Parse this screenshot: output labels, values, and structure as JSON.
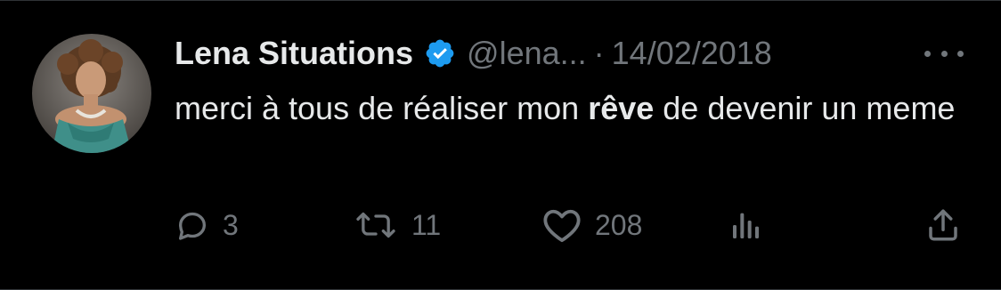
{
  "tweet": {
    "author": {
      "name": "Lena Situations",
      "handle": "@lena...",
      "verified": true
    },
    "separator": "·",
    "date": "14/02/2018",
    "text": {
      "part1": "merci à tous de réaliser mon ",
      "bold": "rêve",
      "part2": " de devenir un meme"
    },
    "actions": {
      "replies": "3",
      "reposts": "11",
      "likes": "208"
    }
  },
  "icons": {
    "verified": "verified-badge-icon",
    "more": "more-options-icon",
    "reply": "reply-icon",
    "repost": "repost-icon",
    "like": "heart-icon",
    "views": "analytics-icon",
    "share": "share-icon"
  },
  "colors": {
    "background": "#000000",
    "text_primary": "#e7e9ea",
    "text_secondary": "#71767b",
    "verified_blue": "#1d9bf0"
  }
}
